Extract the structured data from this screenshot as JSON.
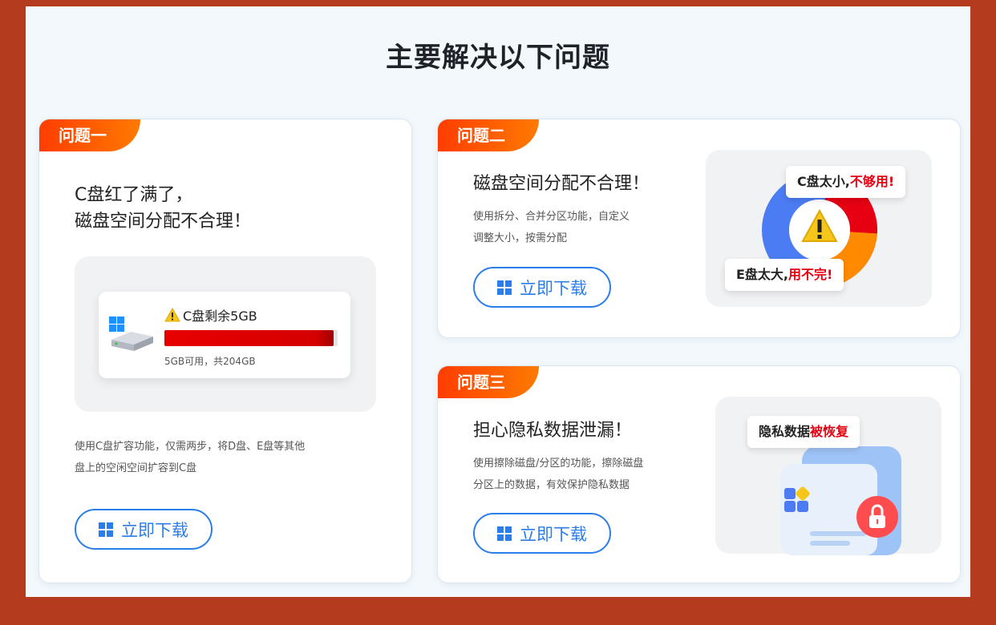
{
  "page": {
    "title": "主要解决以下问题"
  },
  "colors": {
    "accent": "#2b7de9",
    "badge_start": "#ff3d00",
    "badge_end": "#ff7a00",
    "alert_red": "#e60012",
    "frame": "#b53b1f"
  },
  "cards": [
    {
      "badge": "问题一",
      "title_line1": "C盘红了满了，",
      "title_line2": "磁盘空间分配不合理！",
      "desc_line1": "使用C盘扩容功能，仅需两步，将D盘、E盘等其他",
      "desc_line2": "盘上的空闲空间扩容到C盘",
      "button_label": "立即下载",
      "disk": {
        "label": "C盘剩余5GB",
        "usage": "5GB可用，共204GB",
        "used_fraction": 0.9755
      }
    },
    {
      "badge": "问题二",
      "title": "磁盘空间分配不合理！",
      "desc_line1": "使用拆分、合并分区功能，自定义",
      "desc_line2": "调整大小，按需分配",
      "button_label": "立即下载",
      "callout_top_black": "C盘太小,",
      "callout_top_red": "不够用!",
      "callout_bottom_black": "E盘太大,",
      "callout_bottom_red": "用不完!"
    },
    {
      "badge": "问题三",
      "title": "担心隐私数据泄漏！",
      "desc_line1": "使用擦除磁盘/分区的功能，擦除磁盘",
      "desc_line2": "分区上的数据，有效保护隐私数据",
      "button_label": "立即下载",
      "callout_black": "隐私数据",
      "callout_red": "被恢复"
    }
  ],
  "icons": [
    "windows-icon",
    "warning-icon",
    "hdd-icon",
    "lock-icon",
    "pie-chart"
  ]
}
